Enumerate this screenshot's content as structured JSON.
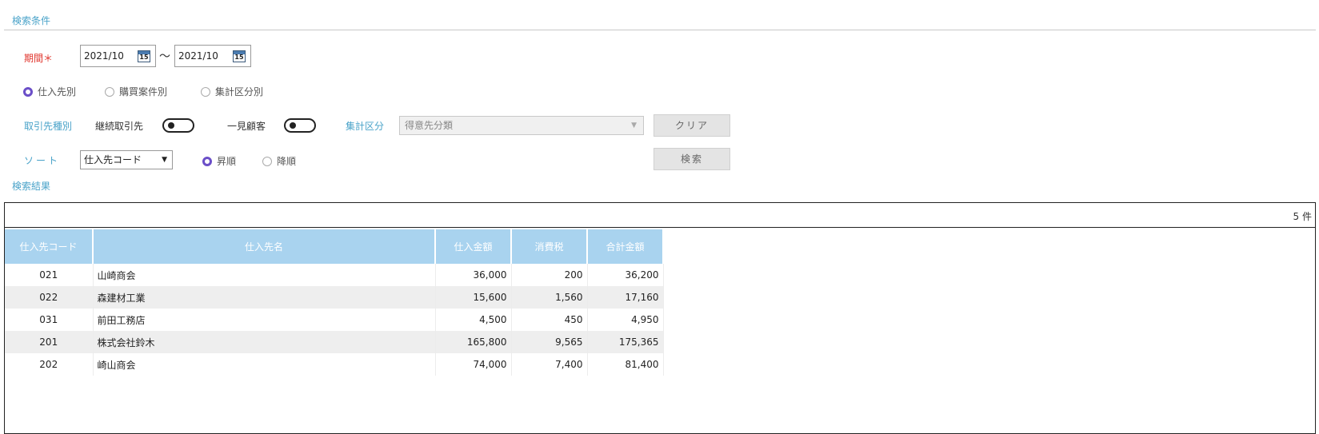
{
  "search_conditions": {
    "section_title": "検索条件"
  },
  "period": {
    "label": "期間",
    "required_mark": "＊",
    "from": "2021/10",
    "to": "2021/10",
    "separator": "～",
    "calendar_day": "15"
  },
  "grouping": {
    "options": [
      {
        "label": "仕入先別",
        "selected": true
      },
      {
        "label": "購買案件別",
        "selected": false
      },
      {
        "label": "集計区分別",
        "selected": false
      }
    ]
  },
  "customer_type": {
    "label": "取引先種別",
    "continuous_label": "継続取引先",
    "walkin_label": "一見顧客"
  },
  "aggregation": {
    "label": "集計区分",
    "value": "得意先分類",
    "clear_button": "クリア"
  },
  "sort": {
    "label": "ソート",
    "value": "仕入先コード",
    "orders": [
      {
        "label": "昇順",
        "selected": true
      },
      {
        "label": "降順",
        "selected": false
      }
    ],
    "search_button": "検索"
  },
  "results": {
    "section_title": "検索結果",
    "count_text": "5 件",
    "columns": [
      "仕入先コード",
      "仕入先名",
      "仕入金額",
      "消費税",
      "合計金額"
    ],
    "rows": [
      [
        "021",
        "山崎商会",
        "36,000",
        "200",
        "36,200"
      ],
      [
        "022",
        "森建材工業",
        "15,600",
        "1,560",
        "17,160"
      ],
      [
        "031",
        "前田工務店",
        "4,500",
        "450",
        "4,950"
      ],
      [
        "201",
        "株式会社鈴木",
        "165,800",
        "9,565",
        "175,365"
      ],
      [
        "202",
        "崎山商会",
        "74,000",
        "7,400",
        "81,400"
      ]
    ]
  },
  "colors": {
    "accent": "#4aa3c9",
    "required": "#e0332b",
    "radio_selected": "#6b4fc8",
    "table_header": "#a9d3ef"
  },
  "icons": {
    "calendar": "calendar-icon",
    "dropdown": "chevron-down-icon"
  }
}
